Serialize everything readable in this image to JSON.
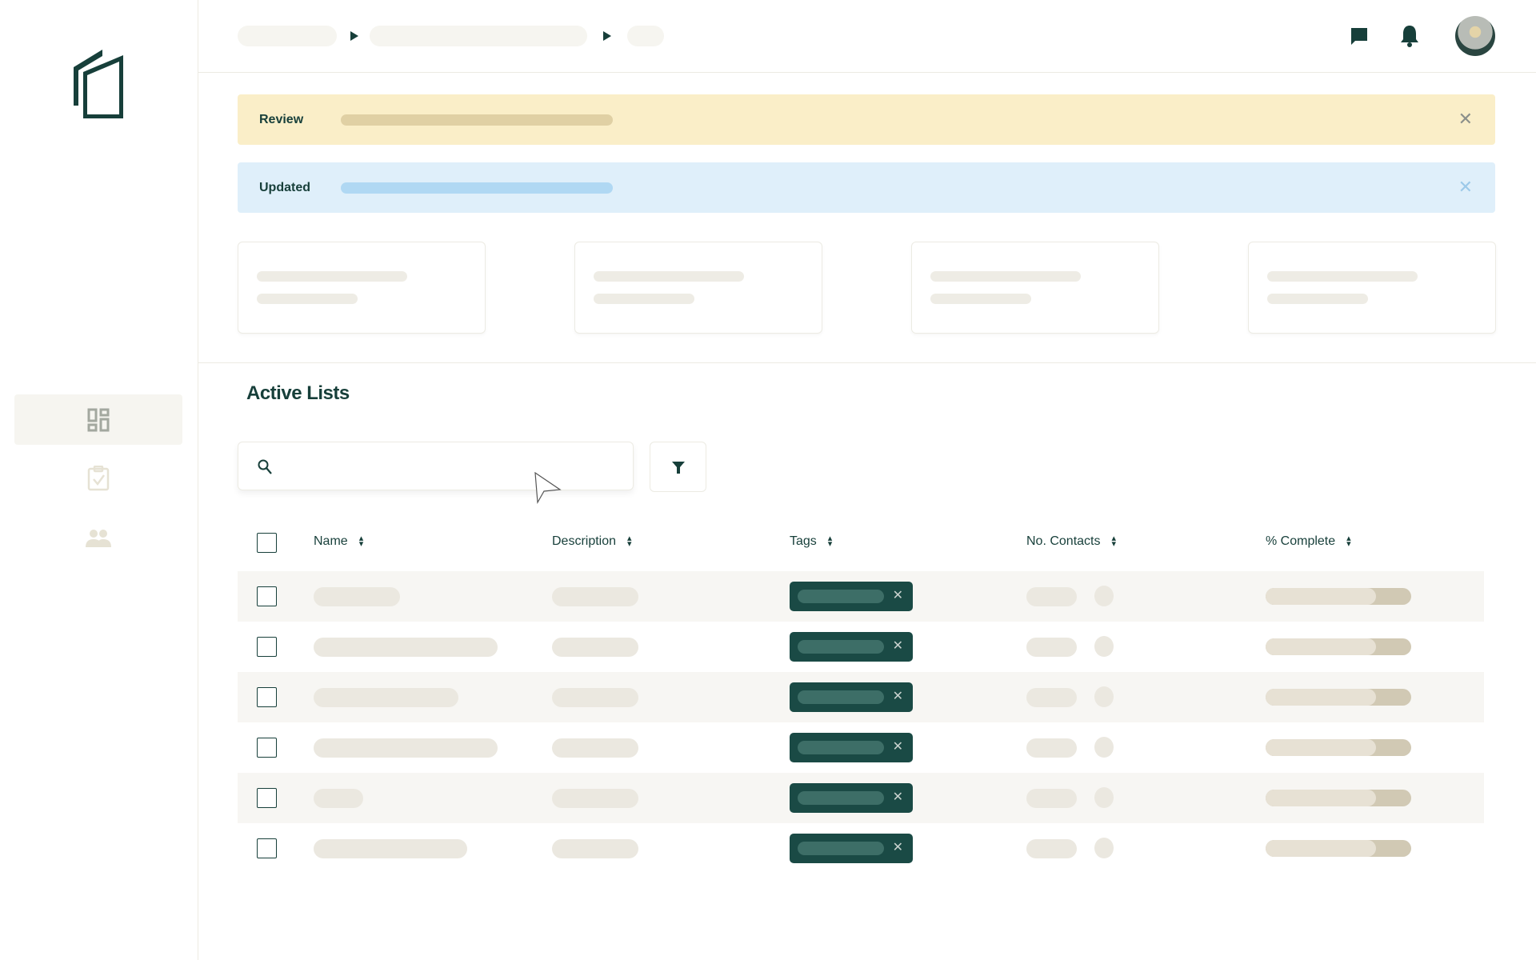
{
  "sidebar": {
    "items": [
      {
        "name": "dashboard",
        "active": true
      },
      {
        "name": "tasks",
        "active": false
      },
      {
        "name": "contacts",
        "active": false
      }
    ]
  },
  "header": {
    "icons": [
      "chat-icon",
      "bell-icon",
      "avatar"
    ]
  },
  "banners": [
    {
      "label": "Review",
      "bg": "#faeec8",
      "bar": "#e0d0a4",
      "x": "#8b8f8a"
    },
    {
      "label": "Updated",
      "bg": "#dfeffa",
      "bar": "#b0d8f3",
      "x": "#9cc9e9"
    }
  ],
  "section": {
    "title": "Active Lists"
  },
  "search": {
    "placeholder": ""
  },
  "table": {
    "columns": [
      "Name",
      "Description",
      "Tags",
      "No. Contacts",
      "% Complete"
    ],
    "rows": [
      {
        "progress": 0.76
      },
      {
        "progress": 0.76
      },
      {
        "progress": 0.76
      },
      {
        "progress": 0.76
      },
      {
        "progress": 0.76
      },
      {
        "progress": 0.76
      }
    ]
  },
  "colors": {
    "brand": "#173f3a",
    "tag": "#1a4a45"
  }
}
